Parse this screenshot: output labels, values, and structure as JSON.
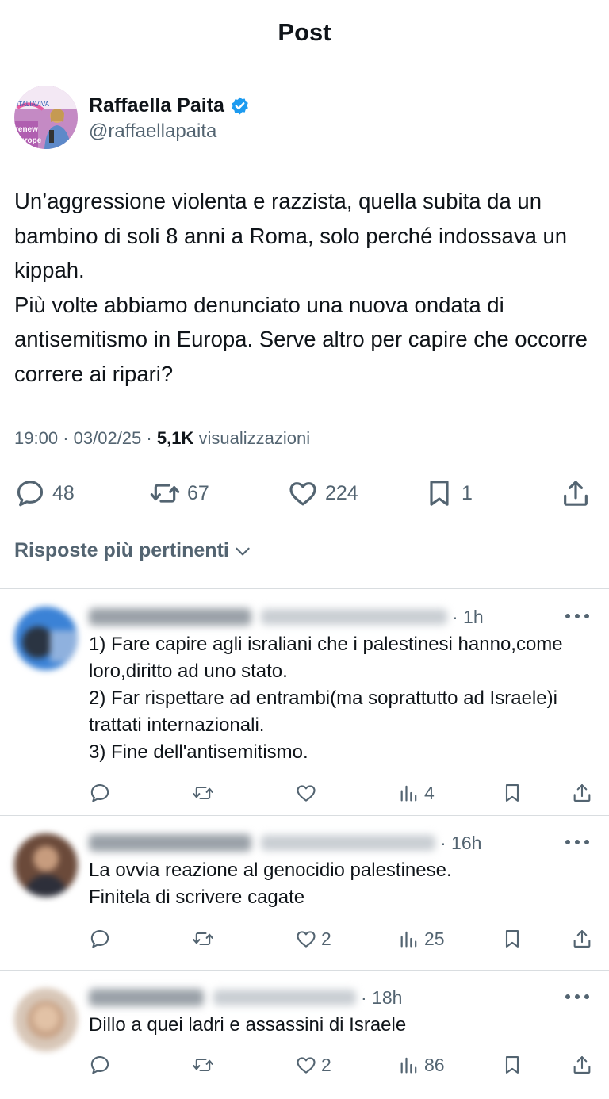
{
  "header": {
    "title": "Post"
  },
  "author": {
    "name": "Raffaella Paita",
    "handle": "@raffaellapaita",
    "verified_color": "#1d9bf0",
    "avatar_text_top": "ITALIAVIVA",
    "avatar_text_side": "renew europe"
  },
  "post": {
    "text": "Un’aggressione violenta e razzista, quella subita da un bambino di soli 8 anni a Roma, solo perché indossava un kippah.\nPiù volte abbiamo denunciato una nuova ondata di antisemitismo in Europa. Serve altro per capire che occorre correre ai ripari?",
    "time": "19:00",
    "date": "03/02/25",
    "views_count": "5,1K",
    "views_label": "visualizzazioni"
  },
  "actions": {
    "replies": "48",
    "reposts": "67",
    "likes": "224",
    "bookmarks": "1"
  },
  "sort": {
    "label": "Risposte più pertinenti"
  },
  "replies": [
    {
      "time": "· 1h",
      "text": "1) Fare capire agli israliani che i palestinesi hanno,come loro,diritto ad uno stato.\n2) Far rispettare ad entrambi(ma soprattutto ad Israele)i trattati internazionali.\n3) Fine dell'antisemitismo.",
      "likes": "",
      "views": "4"
    },
    {
      "time": "· 16h",
      "text": "La  ovvia reazione al genocidio palestinese.\nFinitela di scrivere cagate",
      "likes": "2",
      "views": "25"
    },
    {
      "time": "· 18h",
      "text": "Dillo a quei ladri e assassini di Israele",
      "likes": "2",
      "views": "86"
    }
  ],
  "colors": {
    "text_primary": "#0f1419",
    "text_secondary": "#536471",
    "divider": "#d9dde0",
    "verified": "#1d9bf0"
  },
  "icons": [
    "reply-icon",
    "repost-icon",
    "like-icon",
    "bookmark-icon",
    "share-icon",
    "views-icon",
    "more-icon",
    "chevron-down-icon",
    "verified-badge-icon"
  ]
}
